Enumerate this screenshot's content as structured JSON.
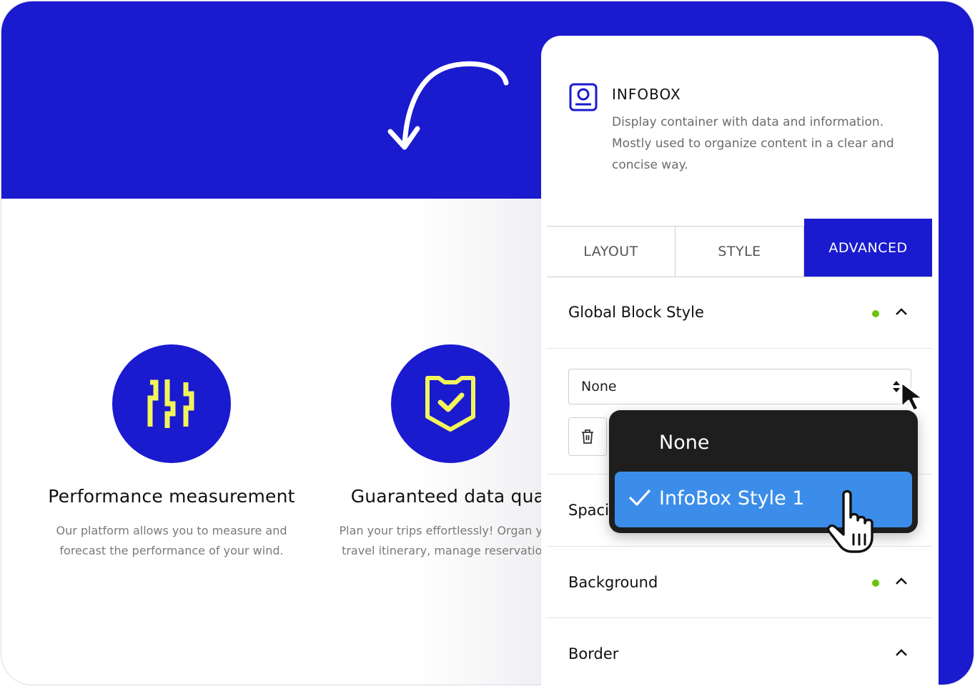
{
  "features": [
    {
      "title": "Performance measurement",
      "description": "Our platform allows you to measure and forecast the performance of your wind.",
      "icon": "sliders-icon"
    },
    {
      "title": "Guaranteed data qual",
      "description": "Plan your trips effortlessly! Organ your travel itinerary, manage reservations.",
      "icon": "shield-check-icon"
    }
  ],
  "panel": {
    "title": "INFOBOX",
    "description": "Display container with data and information. Mostly used to organize content in a clear and concise way.",
    "icon": "infobox-icon",
    "tabs": [
      {
        "label": "LAYOUT",
        "active": false
      },
      {
        "label": "STYLE",
        "active": false
      },
      {
        "label": "ADVANCED",
        "active": true
      }
    ],
    "sections": {
      "global_block_style": "Global Block Style",
      "spacing": "Spaci",
      "background": "Background",
      "border": "Border"
    },
    "select": {
      "value": "None",
      "options": [
        "None",
        "InfoBox Style 1"
      ],
      "highlighted": "InfoBox Style 1"
    }
  },
  "colors": {
    "brand_blue": "#1a1acf",
    "icon_yellow": "#f2f55a",
    "status_dot": "#6ac40f",
    "dropdown_highlight": "#3b8de9",
    "dropdown_bg": "#1e1e1e"
  }
}
